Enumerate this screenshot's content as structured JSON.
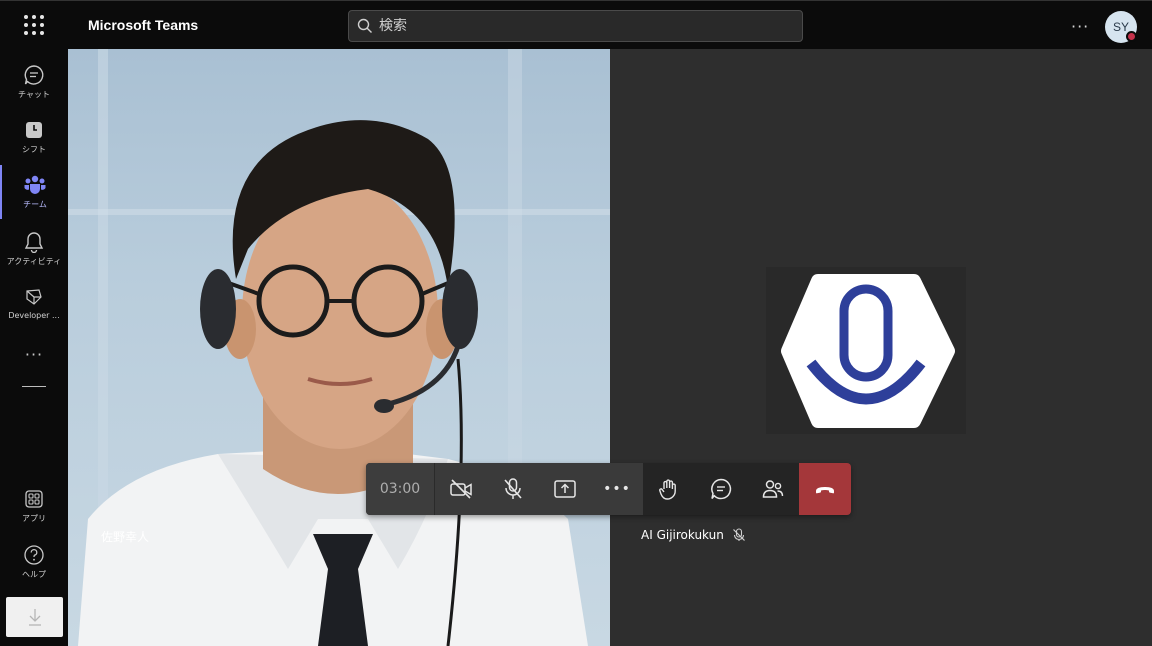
{
  "app": {
    "title": "Microsoft Teams"
  },
  "search": {
    "placeholder": "検索"
  },
  "header": {
    "more": "···",
    "avatar_initials": "SY"
  },
  "rail": {
    "items": [
      {
        "label": "チャット",
        "icon": "chat-icon"
      },
      {
        "label": "シフト",
        "icon": "shifts-icon"
      },
      {
        "label": "チーム",
        "icon": "teams-icon",
        "active": true
      },
      {
        "label": "アクティビティ",
        "icon": "bell-icon"
      },
      {
        "label": "Developer ...",
        "icon": "developer-portal-icon"
      }
    ],
    "more": "···",
    "apps_label": "アプリ",
    "help_label": "ヘルプ"
  },
  "stage": {
    "left_participant": "佐野幸人",
    "right_participant": "AI Gijirokukun"
  },
  "controls": {
    "timer": "03:00",
    "more": "•••"
  },
  "colors": {
    "accent": "#7f85f5",
    "hangup": "#a4373a",
    "presence_busy": "#c4314b",
    "logo_blue": "#2e3f9a"
  }
}
